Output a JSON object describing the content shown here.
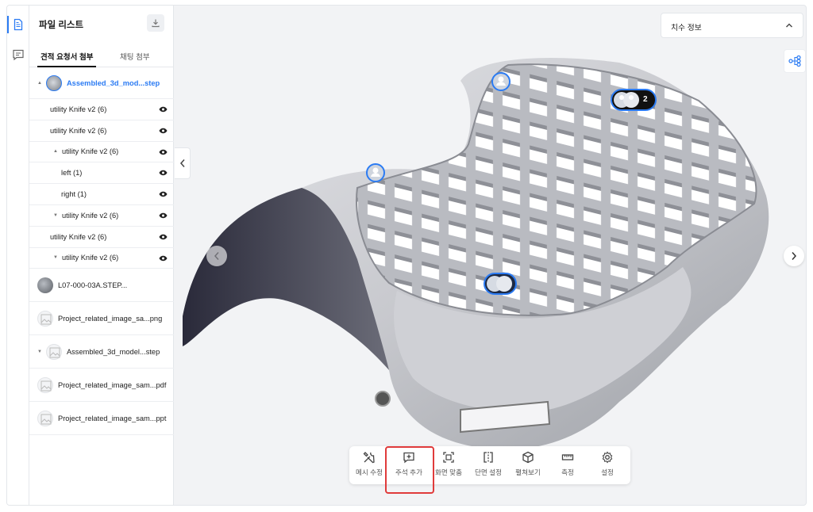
{
  "panel": {
    "title": "파일 리스트",
    "tabs": [
      "견적 요청서 첨부",
      "채팅 첨부"
    ]
  },
  "tree": {
    "root": "Assembled_3d_mod...step",
    "items": [
      {
        "label": "utility Knife v2 (6)",
        "indent": 0,
        "caret": "",
        "eye": true
      },
      {
        "label": "utility Knife v2 (6)",
        "indent": 0,
        "caret": "",
        "eye": true
      },
      {
        "label": "utility Knife v2 (6)",
        "indent": 1,
        "caret": "▲",
        "eye": true
      },
      {
        "label": "left (1)",
        "indent": 2,
        "caret": "",
        "eye": true
      },
      {
        "label": "right (1)",
        "indent": 2,
        "caret": "",
        "eye": true
      },
      {
        "label": "utility Knife v2 (6)",
        "indent": 1,
        "caret": "▼",
        "eye": true
      },
      {
        "label": "utility Knife v2 (6)",
        "indent": 0,
        "caret": "",
        "eye": true
      },
      {
        "label": "utility Knife v2 (6)",
        "indent": 1,
        "caret": "▼",
        "eye": true
      }
    ],
    "files": [
      {
        "label": "L07-000-03A.STEP...",
        "thumb": "dark",
        "caret": ""
      },
      {
        "label": "Project_related_image_sa...png",
        "thumb": "light",
        "caret": ""
      },
      {
        "label": "Assembled_3d_model...step",
        "thumb": "light",
        "caret": "▼"
      },
      {
        "label": "Project_related_image_sam...pdf",
        "thumb": "light",
        "caret": ""
      },
      {
        "label": "Project_related_image_sam...ppt",
        "thumb": "light",
        "caret": ""
      }
    ]
  },
  "viewer": {
    "dim_info_label": "치수 정보",
    "pin_count": "2"
  },
  "toolbar": {
    "tools": [
      {
        "label": "메시 수정",
        "icon": "tools-icon"
      },
      {
        "label": "주석 추가",
        "icon": "add-comment-icon"
      },
      {
        "label": "화면 맞춤",
        "icon": "fit-screen-icon"
      },
      {
        "label": "단면 설정",
        "icon": "section-icon"
      },
      {
        "label": "펼쳐보기",
        "icon": "explode-icon"
      },
      {
        "label": "측정",
        "icon": "ruler-icon"
      },
      {
        "label": "설정",
        "icon": "gear-icon"
      }
    ]
  },
  "colors": {
    "accent": "#2b7bf3",
    "highlight": "#e03b3b"
  }
}
